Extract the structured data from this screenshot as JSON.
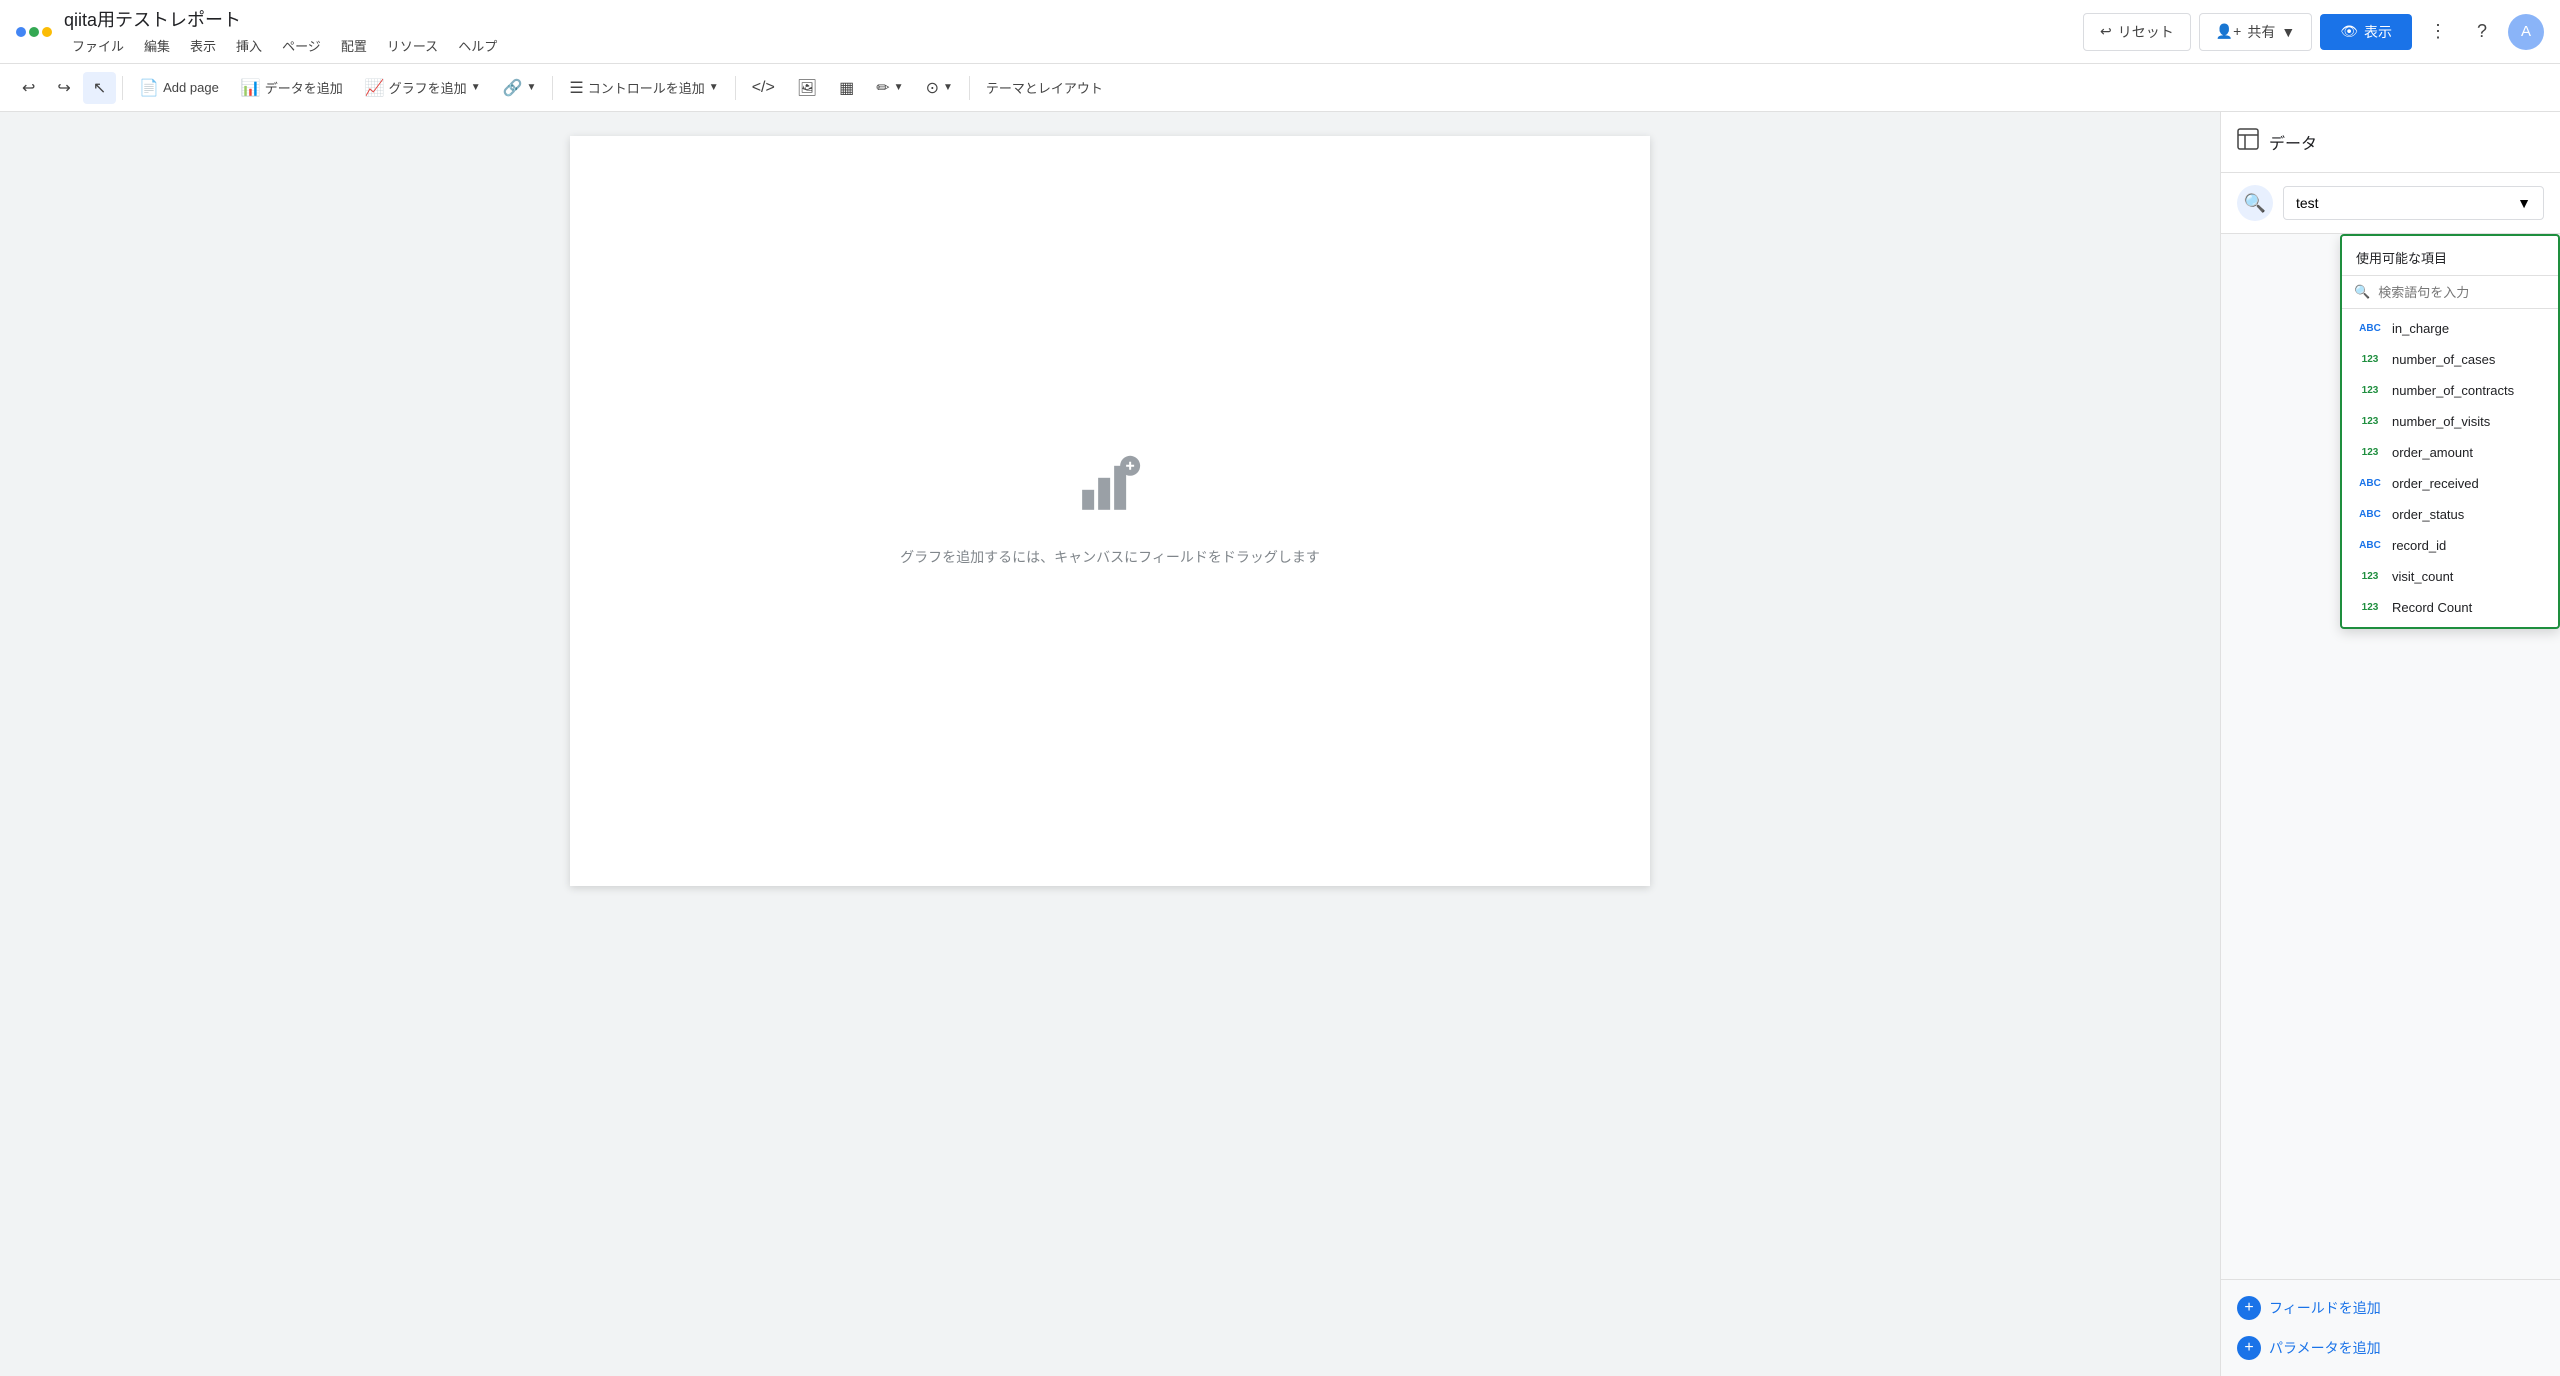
{
  "app": {
    "title": "qiita用テストレポート",
    "logo_colors": [
      "blue",
      "green",
      "yellow"
    ]
  },
  "menu": {
    "items": [
      "ファイル",
      "編集",
      "表示",
      "挿入",
      "ページ",
      "配置",
      "リソース",
      "ヘルプ"
    ]
  },
  "header": {
    "reset_label": "リセット",
    "share_label": "共有",
    "view_label": "表示"
  },
  "toolbar": {
    "add_page_label": "Add page",
    "add_data_label": "データを追加",
    "add_chart_label": "グラフを追加",
    "add_control_label": "コントロールを追加",
    "theme_label": "テーマとレイアウト"
  },
  "right_panel": {
    "title": "データ",
    "data_source": "test",
    "available_fields_title": "使用可能な項目",
    "search_placeholder": "検索語句を入力",
    "fields": [
      {
        "type": "ABC",
        "name": "in_charge"
      },
      {
        "type": "123",
        "name": "number_of_cases"
      },
      {
        "type": "123",
        "name": "number_of_contracts"
      },
      {
        "type": "123",
        "name": "number_of_visits"
      },
      {
        "type": "123",
        "name": "order_amount"
      },
      {
        "type": "ABC",
        "name": "order_received"
      },
      {
        "type": "ABC",
        "name": "order_status"
      },
      {
        "type": "ABC",
        "name": "record_id"
      },
      {
        "type": "123",
        "name": "visit_count"
      },
      {
        "type": "123",
        "name": "Record Count"
      }
    ],
    "add_field_label": "フィールドを追加",
    "add_param_label": "パラメータを追加"
  },
  "canvas": {
    "placeholder_text": "グラフを追加するには、キャンバスにフィールドをドラッグします"
  }
}
